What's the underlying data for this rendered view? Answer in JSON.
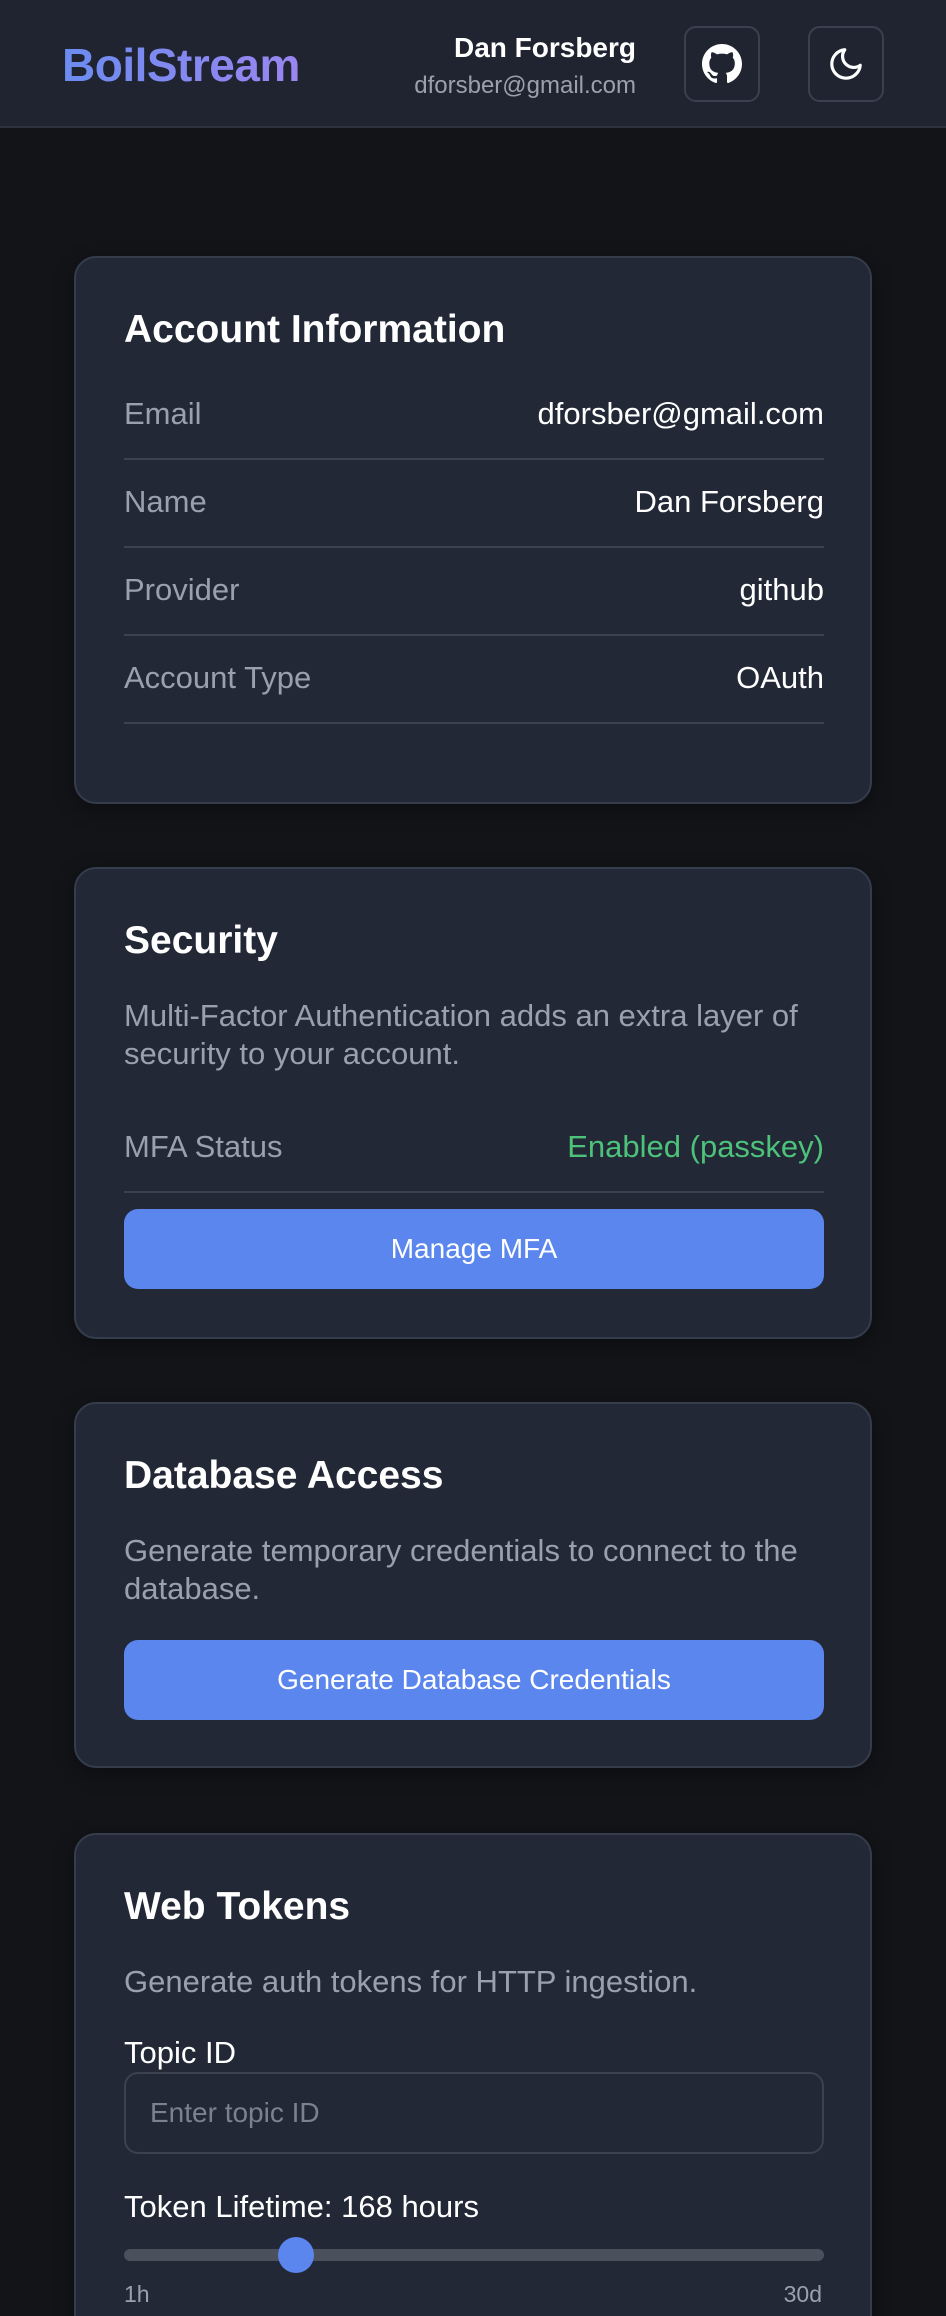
{
  "header": {
    "logo": "BoilStream",
    "user_name": "Dan Forsberg",
    "user_email": "dforsber@gmail.com",
    "github_icon": "github-icon",
    "theme_icon": "moon-icon"
  },
  "account": {
    "title": "Account Information",
    "rows": [
      {
        "label": "Email",
        "value": "dforsber@gmail.com"
      },
      {
        "label": "Name",
        "value": "Dan Forsberg"
      },
      {
        "label": "Provider",
        "value": "github"
      },
      {
        "label": "Account Type",
        "value": "OAuth"
      }
    ]
  },
  "security": {
    "title": "Security",
    "description": "Multi-Factor Authentication adds an extra layer of security to your account.",
    "mfa_label": "MFA Status",
    "mfa_value": "Enabled (passkey)",
    "mfa_color": "#4cc27a",
    "manage_button": "Manage MFA"
  },
  "database": {
    "title": "Database Access",
    "description": "Generate temporary credentials to connect to the database.",
    "generate_button": "Generate Database Credentials"
  },
  "tokens": {
    "title": "Web Tokens",
    "description": "Generate auth tokens for HTTP ingestion.",
    "topic_label": "Topic ID",
    "topic_placeholder": "Enter topic ID",
    "topic_value": "",
    "lifetime_label": "Token Lifetime: 168 hours",
    "lifetime_hours": 168,
    "slider_fraction": 0.245,
    "min_label": "1h",
    "max_label": "30d"
  },
  "colors": {
    "accent": "#5a86ee",
    "background": "#131418",
    "card": "#222836"
  }
}
